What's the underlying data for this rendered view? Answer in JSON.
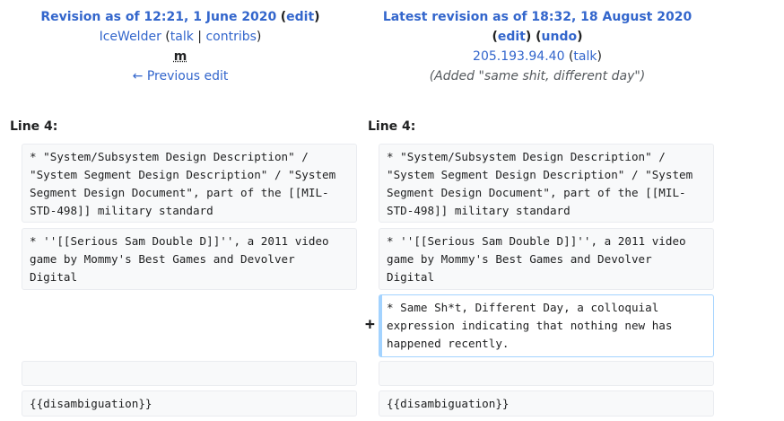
{
  "left_header": {
    "title": "Revision as of 12:21, 1 June 2020",
    "edit": "edit",
    "user": "IceWelder",
    "talk": "talk",
    "contribs": "contribs",
    "minor": "m",
    "prev": "← Previous edit"
  },
  "right_header": {
    "title": "Latest revision as of 18:32, 18 August 2020",
    "edit": "edit",
    "undo": "undo",
    "user": "205.193.94.40",
    "talk": "talk",
    "summary": "(Added \"same shit, different day\")"
  },
  "diff": {
    "left_line": "Line 4:",
    "right_line": "Line 4:",
    "rows": [
      "* \"System/Subsystem Design Description\" / \"System Segment Design Description\" / \"System Segment Design Document\", part of the [[MIL-STD-498]] military standard",
      "* ''[[Serious Sam Double D]]'', a 2011 video game by Mommy's Best Games and Devolver Digital",
      "* Same Sh*t, Different Day, a colloquial expression indicating that nothing new has happened recently.",
      "",
      "{{disambiguation}}"
    ],
    "added_marker": "+"
  }
}
